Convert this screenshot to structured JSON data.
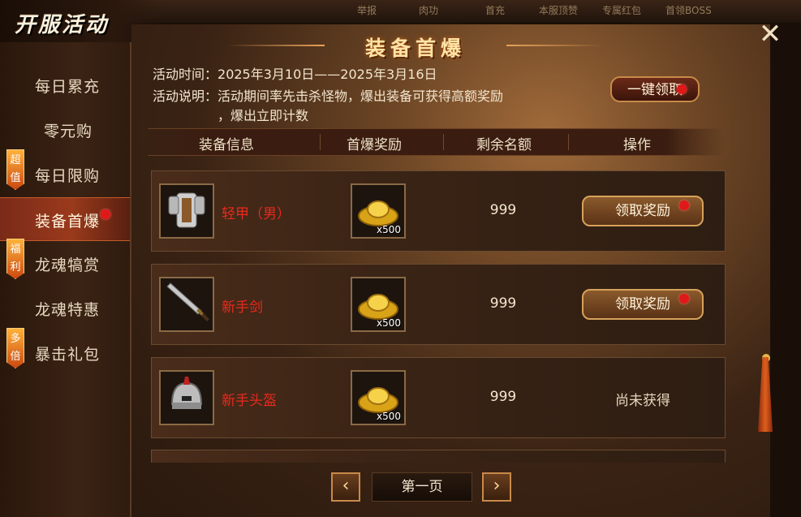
{
  "window": {
    "title": "开服活动"
  },
  "topbar": {
    "items": [
      "举报",
      "肉功",
      "首充",
      "本服顶赞",
      "专属红包",
      "首领BOSS"
    ]
  },
  "sidebar": {
    "items": [
      {
        "label": "每日累充",
        "tag": "",
        "active": false,
        "dot": false
      },
      {
        "label": "零元购",
        "tag": "",
        "active": false,
        "dot": false
      },
      {
        "label": "每日限购",
        "tag": "超值",
        "active": false,
        "dot": false
      },
      {
        "label": "装备首爆",
        "tag": "",
        "active": true,
        "dot": true
      },
      {
        "label": "龙魂犒赏",
        "tag": "福利",
        "active": false,
        "dot": false
      },
      {
        "label": "龙魂特惠",
        "tag": "",
        "active": false,
        "dot": false
      },
      {
        "label": "暴击礼包",
        "tag": "多倍",
        "active": false,
        "dot": false
      }
    ]
  },
  "main": {
    "title": "装备首爆",
    "activity_time_label": "活动时间：",
    "activity_time": "2025年3月10日——2025年3月16日",
    "activity_desc_label": "活动说明：",
    "activity_desc_line1": "活动期间率先击杀怪物，爆出装备可获得高额奖励",
    "activity_desc_line2": "，爆出立即计数",
    "claim_all_label": "一键领取"
  },
  "table": {
    "headers": [
      "装备信息",
      "首爆奖励",
      "剩余名额",
      "操作"
    ],
    "rows": [
      {
        "item_name": "轻甲（男）",
        "item_icon": "light-armor-icon",
        "reward_icon": "gold-ingot-icon",
        "reward_qty": "x500",
        "remaining": "999",
        "action": "领取奖励",
        "action_type": "button",
        "dot": true
      },
      {
        "item_name": "新手剑",
        "item_icon": "sword-icon",
        "reward_icon": "gold-ingot-icon",
        "reward_qty": "x500",
        "remaining": "999",
        "action": "领取奖励",
        "action_type": "button",
        "dot": true
      },
      {
        "item_name": "新手头盔",
        "item_icon": "helmet-icon",
        "reward_icon": "gold-ingot-icon",
        "reward_qty": "x500",
        "remaining": "999",
        "action": "尚未获得",
        "action_type": "status",
        "dot": false
      }
    ]
  },
  "pager": {
    "page_label": "第一页",
    "prev_icon": "chevron-left-icon",
    "next_icon": "chevron-right-icon"
  },
  "colors": {
    "item_name": "#e82a1e",
    "dot": "#e01818",
    "title": "#ffe3a6",
    "accent": "#c88a4a"
  }
}
